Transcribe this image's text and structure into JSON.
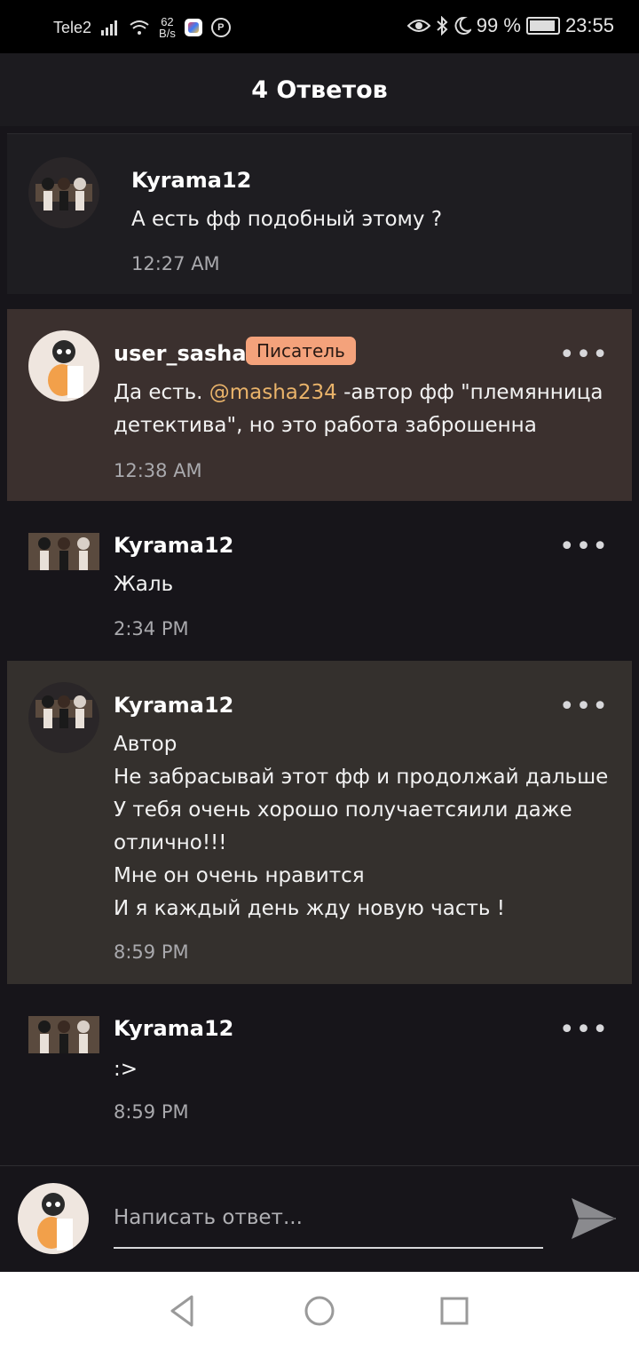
{
  "status_bar": {
    "carrier": "Tele2",
    "net_speed_value": "62",
    "net_speed_unit": "B/s",
    "battery": "99 %",
    "time": "23:55"
  },
  "header": {
    "title": "4 Ответов"
  },
  "comments": [
    {
      "user": "Kyrama12",
      "text": "А есть фф подобный этому ?",
      "time": "12:27 AM"
    },
    {
      "user": "user_sasha",
      "badge": "Писатель",
      "text_before": "Да есть. ",
      "mention": "@masha234",
      "text_after": " -автор фф \"племянница детектива\", но это работа заброшенна",
      "time": "12:38 AM"
    },
    {
      "user": "Kyrama12",
      "text": "Жаль",
      "time": "2:34 PM"
    },
    {
      "user": "Kyrama12",
      "text": "Автор\nНе забрасывай этот фф и продолжай дальше\nУ тебя очень хорошо получаетсяили даже отлично!!!\nМне он очень нравится\nИ я каждый день жду новую часть !",
      "time": "8:59 PM"
    },
    {
      "user": "Kyrama12",
      "text": ":>",
      "time": "8:59 PM"
    }
  ],
  "more_label": "•••",
  "composer": {
    "placeholder": "Написать ответ..."
  },
  "colors": {
    "accent_badge": "#f4a27b",
    "mention": "#e9b36a",
    "highlight_card": "#3b302e"
  }
}
